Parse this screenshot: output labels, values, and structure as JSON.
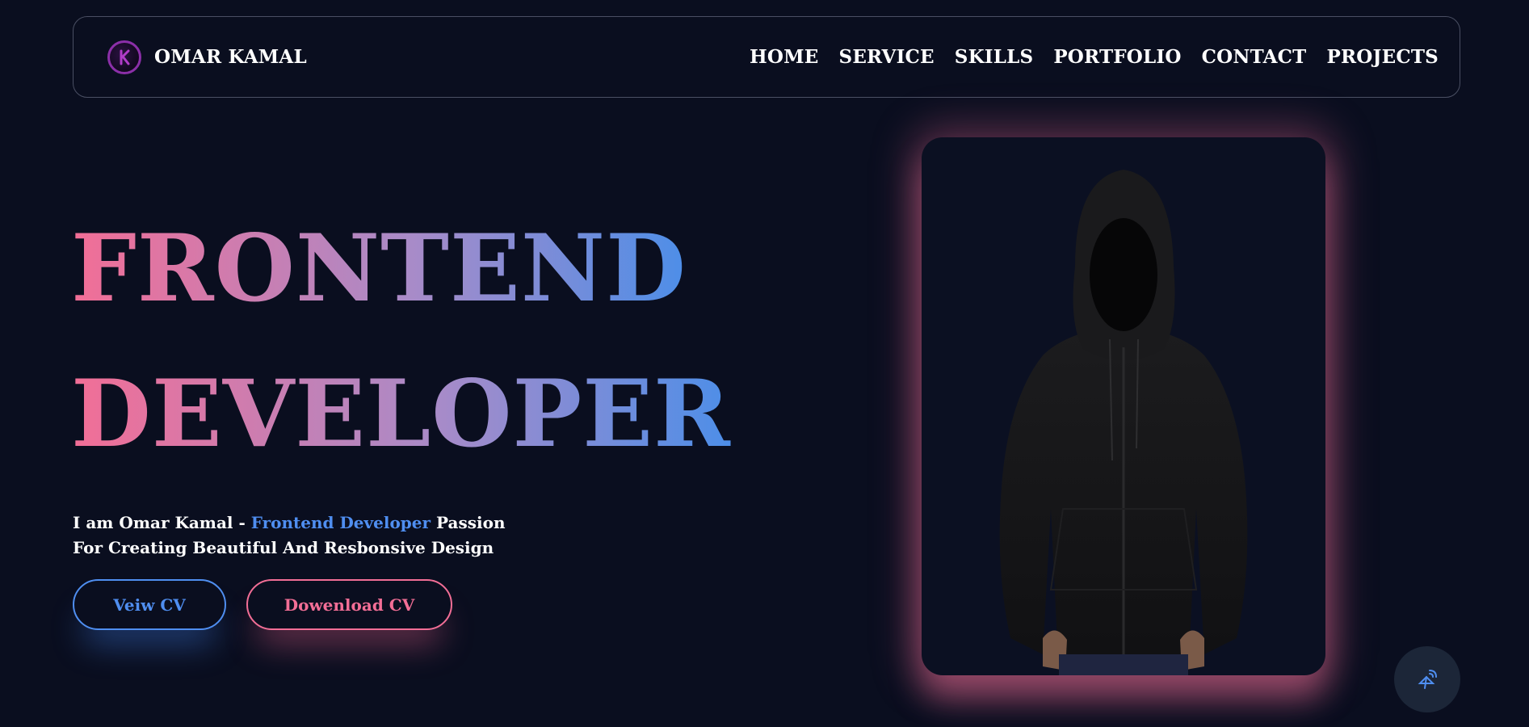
{
  "header": {
    "brand_name": "OMAR KAMAL",
    "logo_icon": "k-monogram-logo",
    "nav": [
      "HOME",
      "SERVICE",
      "SKILLS",
      "PORTFOLIO",
      "CONTACT",
      "PROJECTS"
    ]
  },
  "hero": {
    "title_line1": "FRONTEND",
    "title_line2": "DEVELOPER",
    "intro_prefix": "I am Omar Kamal - ",
    "intro_highlight": "Frontend Developer",
    "intro_suffix": " Passion For Creating Beautiful And Resbonsive Design",
    "view_cv_label": "Veiw CV",
    "download_cv_label": "Dowenload CV",
    "photo_subject": "hooded-figure-portrait"
  },
  "floating_button": {
    "icon": "satellite-signal-icon"
  },
  "colors": {
    "background": "#0a0e1f",
    "accent_pink": "#f26e96",
    "accent_blue": "#4f8ef0",
    "logo_purple": "#8b2fa8"
  }
}
